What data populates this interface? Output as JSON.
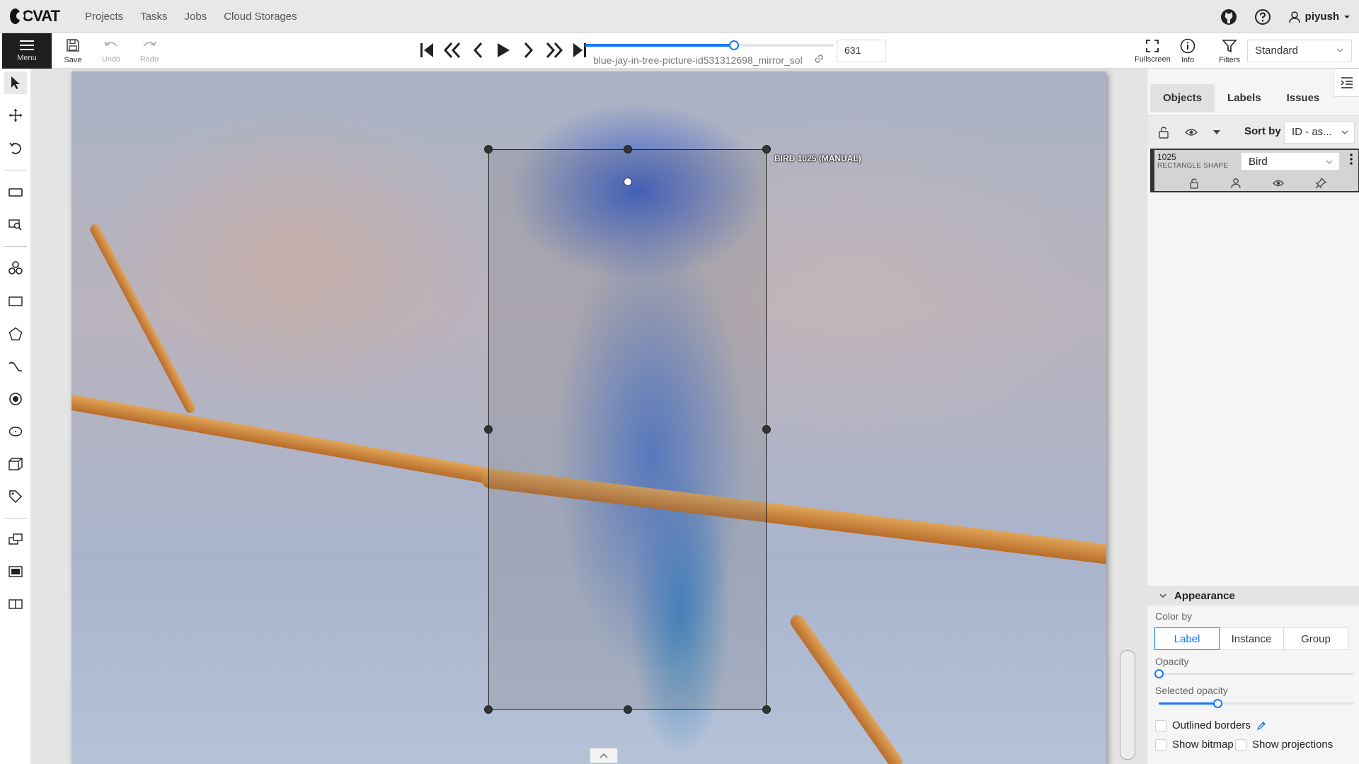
{
  "header": {
    "logo_text": "CVAT",
    "nav": [
      "Projects",
      "Tasks",
      "Jobs",
      "Cloud Storages"
    ],
    "username": "piyush"
  },
  "toolbar": {
    "menu_label": "Menu",
    "save_label": "Save",
    "undo_label": "Undo",
    "redo_label": "Redo",
    "filename": "blue-jay-in-tree-picture-id531312698_mirror_sol",
    "frame_number": "631",
    "frame_progress": 0.6,
    "fullscreen_label": "Fullscreen",
    "info_label": "Info",
    "filters_label": "Filters",
    "workspace": "Standard"
  },
  "canvas": {
    "object_label": "BIRD 1025 (MANUAL)"
  },
  "sidebar": {
    "tabs": [
      "Objects",
      "Labels",
      "Issues"
    ],
    "sort_by_label": "Sort by",
    "sort_value": "ID - as...",
    "object": {
      "id": "1025",
      "type": "RECTANGLE SHAPE",
      "label": "Bird"
    },
    "appearance": {
      "title": "Appearance",
      "color_by_label": "Color by",
      "color_by_options": [
        "Label",
        "Instance",
        "Group"
      ],
      "color_by_selected": "Label",
      "opacity_label": "Opacity",
      "opacity": 0.0,
      "selected_opacity_label": "Selected opacity",
      "selected_opacity": 0.3,
      "outlined_borders_label": "Outlined borders",
      "show_bitmap_label": "Show bitmap",
      "show_projections_label": "Show projections"
    }
  }
}
